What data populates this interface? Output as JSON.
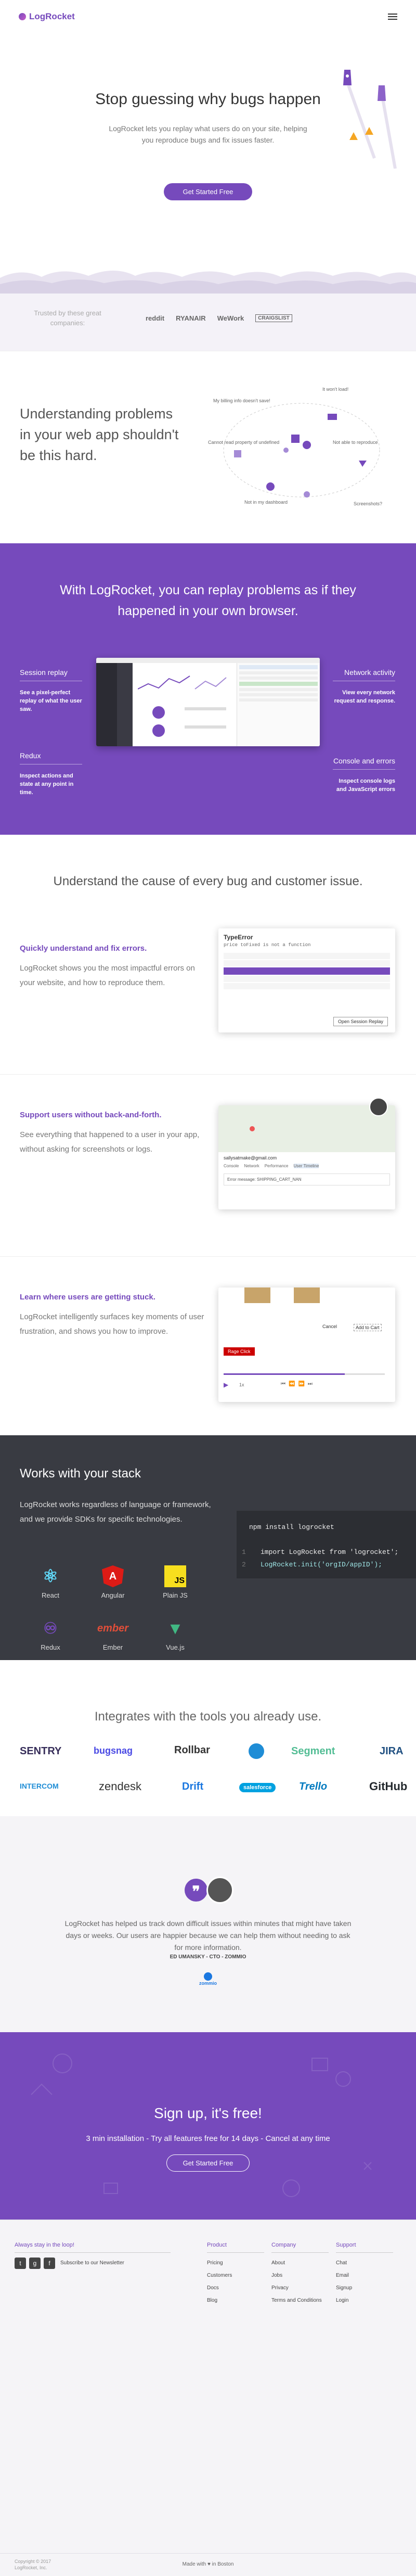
{
  "nav": {
    "brand": "LogRocket"
  },
  "hero": {
    "title": "Stop guessing why bugs happen",
    "subtitle": "LogRocket lets you replay what users do on your site, helping you reproduce bugs and fix issues faster.",
    "cta": "Get Started Free"
  },
  "trusted": {
    "label": "Trusted by these great companies:",
    "logos": [
      "reddit",
      "RYANAIR",
      "WeWork",
      "CRAIGSLIST"
    ]
  },
  "problems": {
    "title": "Understanding problems in your web app shouldn't be this hard.",
    "labels": [
      "My billing info doesn't save!",
      "It won't load!",
      "Cannot read property of undefined",
      "Not able to reproduce",
      "Not in my dashboard",
      "Screenshots?"
    ]
  },
  "replay": {
    "title": "With LogRocket, you can replay problems as if they happened in your own browser.",
    "left": [
      {
        "heading": "Session replay",
        "text": "See a pixel-perfect replay of what the user saw."
      },
      {
        "heading": "Redux",
        "text": "Inspect actions and state at any point in time."
      }
    ],
    "right": [
      {
        "heading": "Network activity",
        "text": "View every network request and response."
      },
      {
        "heading": "Console and errors",
        "text": "Inspect console logs and JavaScript errors"
      }
    ]
  },
  "understand": {
    "title": "Understand the cause of every bug and customer issue.",
    "features": [
      {
        "heading": "Quickly understand and fix errors.",
        "text": "LogRocket shows you the most impactful errors on your website, and how to reproduce them."
      },
      {
        "heading": "Support users without back-and-forth.",
        "text": "See everything that happened to a user in your app, without asking for screenshots or logs."
      },
      {
        "heading": "Learn where users are getting stuck.",
        "text": "LogRocket intelligently surfaces key moments of user frustration, and shows you how to improve."
      }
    ],
    "error_box": {
      "title": "TypeError",
      "subtitle": "price toFixed is not a function",
      "button": "Open Session Replay"
    },
    "support_box": {
      "email": "sallysatmake@gmail.com",
      "tabs": [
        "Console",
        "Network",
        "Performance",
        "User Timeline"
      ],
      "error_text": "Error message: SHIPPING_CART_NAN"
    },
    "stuck_box": {
      "cancel": "Cancel",
      "add": "Add to Cart",
      "badge": "Rage Click",
      "speed": "1x"
    }
  },
  "stack": {
    "title": "Works with your stack",
    "text": "LogRocket works regardless of language or framework, and we provide SDKs for specific technologies.",
    "techs": [
      "React",
      "Angular",
      "Plain JS",
      "Redux",
      "Ember",
      "Vue.js"
    ],
    "code": [
      "npm install logrocket",
      "import LogRocket from 'logrocket';",
      "LogRocket.init('orgID/appID');"
    ]
  },
  "integrations": {
    "title": "Integrates with the tools you already use.",
    "logos": [
      "SENTRY",
      "bugsnag",
      "Rollbar",
      "Segment",
      "JIRA",
      "INTERCOM",
      "zendesk",
      "Drift",
      "salesforce",
      "Trello",
      "GitHub"
    ]
  },
  "testimonial": {
    "quote": "LogRocket has helped us track down difficult issues within minutes that might have taken days or weeks. Our users are happier because we can help them without needing to ask for more information.",
    "author": "ED UMANSKY - CTO - ZOMMIO",
    "company": "zommio"
  },
  "signup": {
    "title": "Sign up, it's free!",
    "text": "3 min installation - Try all features free for 14 days - Cancel at any time",
    "cta": "Get Started Free"
  },
  "footer": {
    "loop_title": "Always stay in the loop!",
    "newsletter": "Subscribe to our Newsletter",
    "columns": [
      {
        "title": "Product",
        "items": [
          "Pricing",
          "Customers",
          "Docs",
          "Blog"
        ]
      },
      {
        "title": "Company",
        "items": [
          "About",
          "Jobs",
          "Privacy",
          "Terms and Conditions"
        ]
      },
      {
        "title": "Support",
        "items": [
          "Chat",
          "Email",
          "Signup",
          "Login"
        ]
      }
    ],
    "copyright": "Copyright © 2017 LogRocket, Inc.",
    "made": "Made with ♥ in Boston"
  },
  "colors": {
    "brand": "#764abc",
    "dark": "#393b42"
  }
}
